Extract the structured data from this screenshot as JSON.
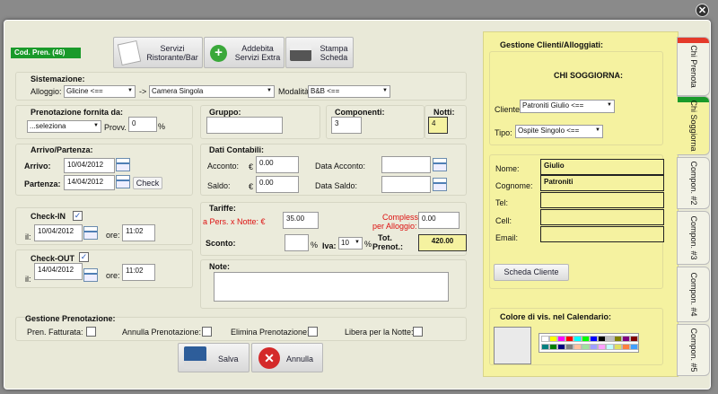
{
  "header": {
    "code_badge": "Cod. Pren. (46)",
    "btn_services": "Servizi Ristorante/Bar",
    "btn_charge": "Addebita Servizi Extra",
    "btn_print": "Stampa Scheda"
  },
  "sistemazione": {
    "title": "Sistemazione:",
    "alloggio_label": "Alloggio:",
    "alloggio_value": "Glicine <==",
    "arrow": "->",
    "room_value": "Camera Singola",
    "modalita_label": "Modalità:",
    "modalita_value": "B&B <=="
  },
  "prenotazione": {
    "title": "Prenotazione fornita da:",
    "source_value": "...seleziona",
    "provv_label": "Provv.",
    "provv_value": "0",
    "pct": "%"
  },
  "gruppo": {
    "title": "Gruppo:",
    "value": ""
  },
  "componenti": {
    "title": "Componenti:",
    "value": "3"
  },
  "notti": {
    "title": "Notti:",
    "value": "4"
  },
  "arrivo_partenza": {
    "title": "Arrivo/Partenza:",
    "arrivo_label": "Arrivo:",
    "arrivo_value": "10/04/2012",
    "partenza_label": "Partenza:",
    "partenza_value": "14/04/2012",
    "check_button": "Check"
  },
  "dati_contabili": {
    "title": "Dati Contabili:",
    "acconto_label": "Acconto:",
    "acconto_value": "0.00",
    "saldo_label": "Saldo:",
    "saldo_value": "0.00",
    "currency": "€",
    "data_acconto_label": "Data Acconto:",
    "data_saldo_label": "Data Saldo:"
  },
  "checkin": {
    "title": "Check-IN",
    "checked": "✓",
    "il_label": "il:",
    "date": "10/04/2012",
    "ore_label": "ore:",
    "time": "11:02"
  },
  "checkout": {
    "title": "Check-OUT",
    "checked": "✓",
    "il_label": "il:",
    "date": "14/04/2012",
    "ore_label": "ore:",
    "time": "11:02"
  },
  "tariffe": {
    "title": "Tariffe:",
    "per_night_label": "a Pers. x Notte: €",
    "per_night_value": "35.00",
    "compless_label_1": "Compless.",
    "compless_label_2": "per Alloggio:",
    "compless_value": "0.00",
    "sconto_label": "Sconto:",
    "sconto_value": "",
    "pct": "%",
    "iva_label": "Iva:",
    "iva_value": "10",
    "tot_label_1": "Tot.",
    "tot_label_2": "Prenot.:",
    "tot_value": "420.00"
  },
  "note": {
    "title": "Note:",
    "value": ""
  },
  "gestione": {
    "title": "Gestione Prenotazione:",
    "fatturata": "Pren. Fatturata:",
    "annulla": "Annulla Prenotazione:",
    "elimina": "Elimina Prenotazione:",
    "libera": "Libera per la Notte:"
  },
  "footer": {
    "save": "Salva",
    "cancel": "Annulla"
  },
  "clienti": {
    "title": "Gestione Clienti/Alloggiati:",
    "chi_soggiorna": "CHI SOGGIORNA:",
    "cliente_label": "Cliente:",
    "cliente_value": "Patroniti Giulio <==",
    "tipo_label": "Tipo:",
    "tipo_value": "Ospite Singolo <==",
    "nome_label": "Nome:",
    "nome_value": "Giulio",
    "cognome_label": "Cognome:",
    "cognome_value": "Patroniti",
    "tel_label": "Tel:",
    "tel_value": "",
    "cell_label": "Cell:",
    "cell_value": "",
    "email_label": "Email:",
    "email_value": "",
    "scheda_button": "Scheda Cliente",
    "colore_title": "Colore di vis. nel Calendario:"
  },
  "tabs": [
    "Chi Prenota",
    "Chi Soggiorna",
    "Compon. #2",
    "Compon. #3",
    "Compon. #4",
    "Compon. #5"
  ],
  "colors": {
    "accent_green": "#1a9a2a",
    "note_yellow": "#f5f2a0",
    "palette": [
      "#ffffff",
      "#ffff00",
      "#ff00ff",
      "#ff0000",
      "#00ffff",
      "#00ff00",
      "#0000ff",
      "#000000",
      "#c0c0c0",
      "#808000",
      "#800080",
      "#800000",
      "#008080",
      "#008000",
      "#000080",
      "#808080",
      "#ffc0a0",
      "#a0e0a0",
      "#a0a0ff",
      "#ffa0ff",
      "#c0ffff",
      "#e0e060",
      "#ff8040",
      "#40a0ff"
    ]
  }
}
